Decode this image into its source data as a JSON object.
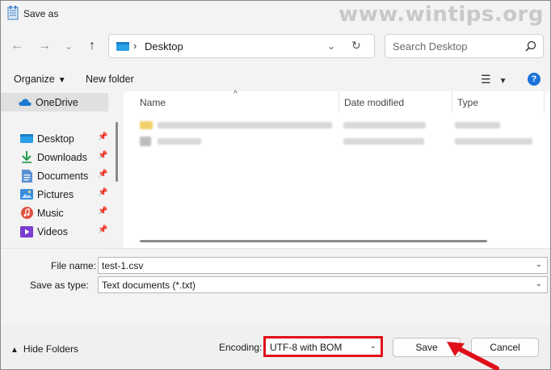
{
  "window": {
    "title": "Save as"
  },
  "watermark": "www.wintips.org",
  "nav": {
    "back_icon": "arrow-left-icon",
    "forward_icon": "arrow-right-icon",
    "recent_icon": "chevron-down-icon",
    "up_icon": "arrow-up-icon",
    "address": {
      "location": "Desktop",
      "separator": "›"
    },
    "search": {
      "placeholder": "Search Desktop"
    }
  },
  "toolbar": {
    "organize_label": "Organize",
    "new_folder_label": "New folder"
  },
  "sidebar": {
    "items": [
      {
        "label": "OneDrive",
        "icon": "cloud-icon",
        "pinned": false
      },
      {
        "label": "Desktop",
        "icon": "desktop-icon",
        "pinned": true
      },
      {
        "label": "Downloads",
        "icon": "download-icon",
        "pinned": true
      },
      {
        "label": "Documents",
        "icon": "document-icon",
        "pinned": true
      },
      {
        "label": "Pictures",
        "icon": "picture-icon",
        "pinned": true
      },
      {
        "label": "Music",
        "icon": "music-icon",
        "pinned": true
      },
      {
        "label": "Videos",
        "icon": "video-icon",
        "pinned": true
      }
    ]
  },
  "filelist": {
    "columns": [
      "Name",
      "Date modified",
      "Type"
    ]
  },
  "form": {
    "file_name_label": "File name:",
    "file_name_value": "test-1.csv",
    "save_type_label": "Save as type:",
    "save_type_value": "Text documents (*.txt)"
  },
  "bottom": {
    "hide_folders_label": "Hide Folders",
    "encoding_label": "Encoding:",
    "encoding_value": "UTF-8 with BOM",
    "save_label": "Save",
    "cancel_label": "Cancel"
  },
  "colors": {
    "accent": "#1a73d9",
    "highlight_red": "#e0101a"
  }
}
